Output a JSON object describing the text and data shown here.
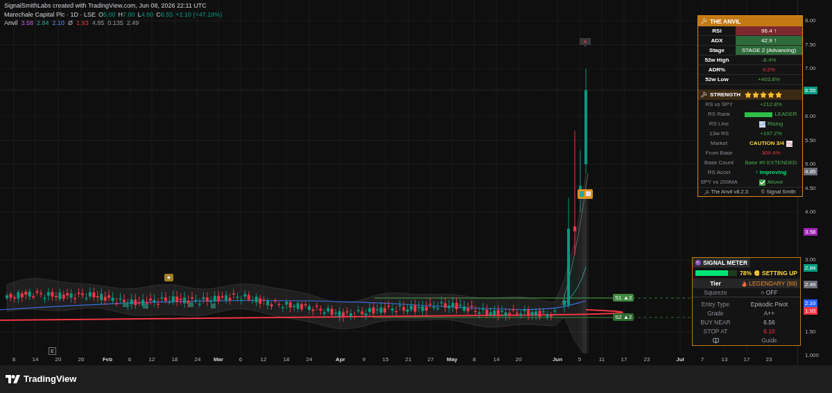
{
  "snapshot_header": "SignalSmithLabs created with TradingView.com, Jun 08, 2026 22:11 UTC",
  "legend": {
    "symbol": "Marechale Capital Plc · 1D · LSE",
    "ohlc": [
      {
        "label": "O",
        "value": "5.00"
      },
      {
        "label": "H",
        "value": "7.00"
      },
      {
        "label": "L",
        "value": "4.80"
      },
      {
        "label": "C",
        "value": "6.55"
      }
    ],
    "change": "+2.10 (+47.19%)"
  },
  "indicator": {
    "name": "Anvil",
    "values": [
      "3.58",
      "2.84",
      "2.10",
      "Ø",
      "1.93",
      "4.85",
      "0.135",
      "2.49"
    ]
  },
  "chart_labels": [
    {
      "text": "S1 ▲2"
    },
    {
      "text": "S2 ▲2"
    }
  ],
  "earnings_marker": "E",
  "price_axis": {
    "ticks": [
      "8.00",
      "7.50",
      "7.00",
      "6.00",
      "5.50",
      "5.00",
      "4.50",
      "4.00",
      "3.00",
      "1.50",
      "1.000"
    ],
    "badges": [
      {
        "text": "6.55",
        "color": "#089981"
      },
      {
        "text": "4.85",
        "color": "#6a6d78"
      },
      {
        "text": "3.58",
        "color": "#9c27b0"
      },
      {
        "text": "2.84",
        "color": "#089981"
      },
      {
        "text": "2.49",
        "color": "#6a6d78"
      },
      {
        "text": "2.10",
        "color": "#2962ff"
      },
      {
        "text": "1.93",
        "color": "#f23645"
      }
    ]
  },
  "time_axis": [
    {
      "label": "8",
      "kind": "day"
    },
    {
      "label": "14",
      "kind": "day"
    },
    {
      "label": "20",
      "kind": "day"
    },
    {
      "label": "26",
      "kind": "day"
    },
    {
      "label": "Feb",
      "kind": "month"
    },
    {
      "label": "6",
      "kind": "day"
    },
    {
      "label": "12",
      "kind": "day"
    },
    {
      "label": "18",
      "kind": "day"
    },
    {
      "label": "24",
      "kind": "day"
    },
    {
      "label": "Mar",
      "kind": "month"
    },
    {
      "label": "6",
      "kind": "day"
    },
    {
      "label": "12",
      "kind": "day"
    },
    {
      "label": "18",
      "kind": "day"
    },
    {
      "label": "24",
      "kind": "day"
    },
    {
      "label": "Apr",
      "kind": "month"
    },
    {
      "label": "9",
      "kind": "day"
    },
    {
      "label": "15",
      "kind": "day"
    },
    {
      "label": "21",
      "kind": "day"
    },
    {
      "label": "27",
      "kind": "day"
    },
    {
      "label": "May",
      "kind": "month"
    },
    {
      "label": "8",
      "kind": "day"
    },
    {
      "label": "14",
      "kind": "day"
    },
    {
      "label": "20",
      "kind": "day"
    },
    {
      "label": "Jun",
      "kind": "month"
    },
    {
      "label": "5",
      "kind": "day"
    },
    {
      "label": "11",
      "kind": "day"
    },
    {
      "label": "17",
      "kind": "day"
    },
    {
      "label": "23",
      "kind": "day"
    },
    {
      "label": "Jul",
      "kind": "month"
    },
    {
      "label": "7",
      "kind": "day"
    },
    {
      "label": "13",
      "kind": "day"
    },
    {
      "label": "17",
      "kind": "day"
    },
    {
      "label": "23",
      "kind": "day"
    }
  ],
  "anvil": {
    "title": "THE ANVIL",
    "rows": [
      {
        "label": "RSI",
        "value": "96.4 ↑",
        "color": "#7b2a2d"
      },
      {
        "label": "ADX",
        "value": "42.9 ↑",
        "color": "#2e6b3a"
      },
      {
        "label": "Stage",
        "value": "STAGE 2 (Advancing)",
        "color": "#2e6b3a"
      },
      {
        "label": "52w High",
        "value": "-6.4%"
      },
      {
        "label": "ADR%",
        "value": "9.2%"
      },
      {
        "label": "52w Low",
        "value": "+403.8%"
      }
    ],
    "strength": {
      "title": "STRENGTH",
      "stars": 5,
      "rows": [
        {
          "kind": "text",
          "label": "RS vs SPY",
          "value": "+212.8%"
        },
        {
          "kind": "bar",
          "label": "RS Rank",
          "value": "LEADER",
          "level": 1
        },
        {
          "kind": "rising",
          "label": "RS Line",
          "value": "Rising"
        },
        {
          "kind": "text",
          "label": "13w RS",
          "value": "+197.2%"
        },
        {
          "kind": "falling",
          "label": "Market",
          "value": "CAUTION 3/4"
        },
        {
          "kind": "text",
          "label": "From Base",
          "value": "309.4%"
        },
        {
          "kind": "text",
          "label": "Base Count",
          "value": "Base #0 EXTENDED"
        },
        {
          "kind": "text",
          "label": "RS Accel",
          "value": "↑ Improving"
        },
        {
          "kind": "check",
          "label": "SPY vs 200MA",
          "value": "Above"
        }
      ]
    },
    "version": "The Anvil v8.2.3",
    "credit": "© Signal Smith"
  },
  "signal_meter": {
    "title": "SIGNAL METER",
    "level": 0.78,
    "percent": "78%",
    "status": "SETTING UP",
    "tier": {
      "label": "Tier",
      "value": "LEGENDARY (89)"
    },
    "rows": [
      {
        "label": "Squeeze",
        "value": "○ OFF"
      },
      {
        "label": "Entry Type",
        "value": "Episodic Pivot"
      },
      {
        "label": "Grade",
        "value": "A++"
      },
      {
        "label": "BUY NEAR",
        "value": "6.56"
      },
      {
        "label": "STOP AT",
        "value": "6.10"
      }
    ],
    "guide": "Guide"
  },
  "footer": {
    "brand": "TradingView"
  }
}
